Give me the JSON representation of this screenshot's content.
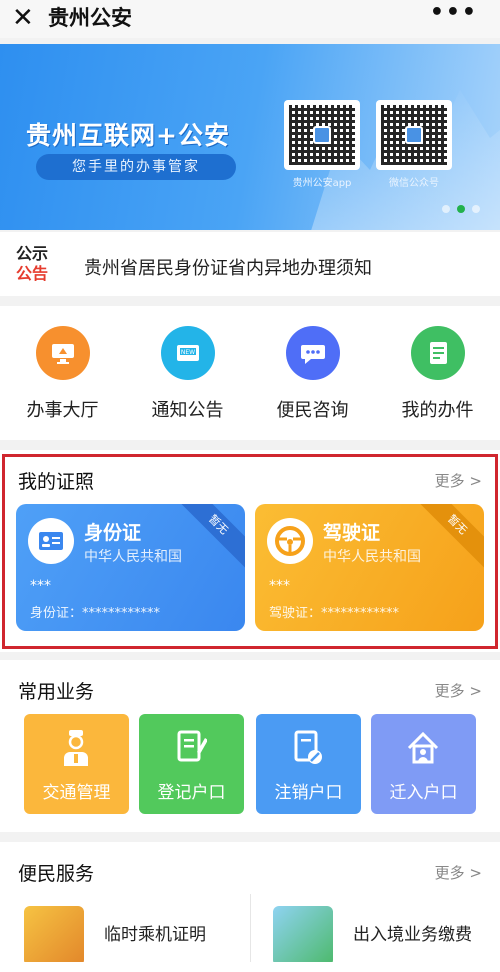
{
  "topbar": {
    "close_glyph": "✕",
    "title": "贵州公安",
    "more_glyph": "•••"
  },
  "banner": {
    "headline": "贵州互联网+公安",
    "slogan": "您手里的办事管家",
    "qr_codes": [
      {
        "label": "贵州公安app"
      },
      {
        "label": "微信公众号"
      }
    ],
    "dots": 3,
    "active_dot": 1
  },
  "notice": {
    "tag_line1": "公示",
    "tag_line2": "公告",
    "text": "贵州省居民身份证省内异地办理须知"
  },
  "shortcuts": [
    {
      "label": "办事大厅",
      "icon": "monitor-icon",
      "color": "#f7902e"
    },
    {
      "label": "通知公告",
      "icon": "news-icon",
      "color": "#23b4e8"
    },
    {
      "label": "便民咨询",
      "icon": "chat-icon",
      "color": "#4f6ef7"
    },
    {
      "label": "我的办件",
      "icon": "document-icon",
      "color": "#3fbf63"
    }
  ],
  "licenses": {
    "title": "我的证照",
    "more": "更多 >",
    "cards": [
      {
        "name": "身份证",
        "issuer": "中华人民共和国",
        "holder": "***",
        "number": "身份证：************",
        "ribbon": "暂无",
        "color": "#3f8ff3"
      },
      {
        "name": "驾驶证",
        "issuer": "中华人民共和国",
        "holder": "***",
        "number": "驾驶证：************",
        "ribbon": "暂无",
        "color": "#f7a91c"
      }
    ]
  },
  "common": {
    "title": "常用业务",
    "more": "更多 >",
    "items": [
      {
        "label": "交通管理",
        "color": "#fbb73c"
      },
      {
        "label": "登记户口",
        "color": "#52c95c"
      },
      {
        "label": "注销户口",
        "color": "#4b9bf3"
      },
      {
        "label": "迁入户口",
        "color": "#7f9bf5"
      }
    ]
  },
  "convenience": {
    "title": "便民服务",
    "more": "更多 >",
    "items": [
      {
        "label": "临时乘机证明"
      },
      {
        "label": "出入境业务缴费"
      }
    ]
  }
}
